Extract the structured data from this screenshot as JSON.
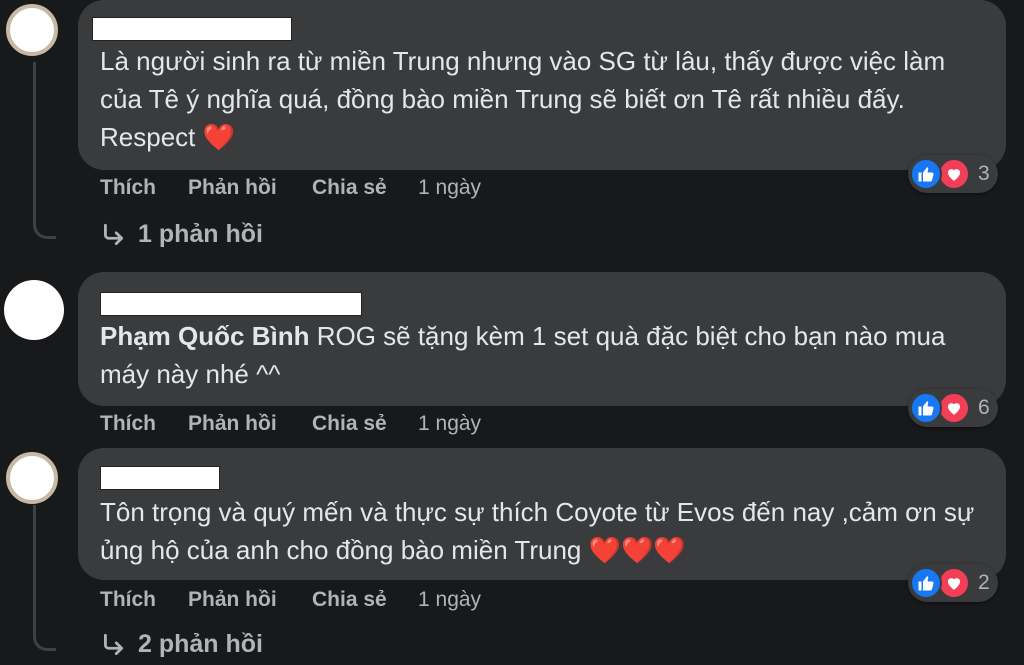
{
  "comments": [
    {
      "text": "Là người sinh ra từ miền Trung nhưng vào SG từ lâu, thấy được việc làm của Tê ý nghĩa quá, đồng bào miền Trung sẽ biết ơn Tê rất nhiều đấy. Respect",
      "hearts": "❤️",
      "actions": {
        "like": "Thích",
        "reply": "Phản hồi",
        "share": "Chia sẻ",
        "time": "1 ngày"
      },
      "reaction_count": "3",
      "replies": "1 phản hồi"
    },
    {
      "mention": "Phạm Quốc Bình",
      "text": " ROG sẽ tặng kèm 1 set quà đặc biệt cho bạn nào mua máy này nhé ^^",
      "actions": {
        "like": "Thích",
        "reply": "Phản hồi",
        "share": "Chia sẻ",
        "time": "1 ngày"
      },
      "reaction_count": "6"
    },
    {
      "text": "Tôn trọng và quý mến và thực sự thích Coyote từ Evos đến nay ,cảm ơn sự ủng hộ của anh cho đồng bào miền Trung",
      "hearts": "❤️❤️❤️",
      "actions": {
        "like": "Thích",
        "reply": "Phản hồi",
        "share": "Chia sẻ",
        "time": "1 ngày"
      },
      "reaction_count": "2",
      "replies": "2 phản hồi"
    }
  ],
  "icons": {
    "reply_arrow": "reply-arrow-icon",
    "like": "like-icon",
    "love": "love-icon"
  },
  "colors": {
    "background": "#18191a",
    "bubble": "#3a3b3c",
    "like": "#1877f2",
    "love": "#f33e58"
  }
}
